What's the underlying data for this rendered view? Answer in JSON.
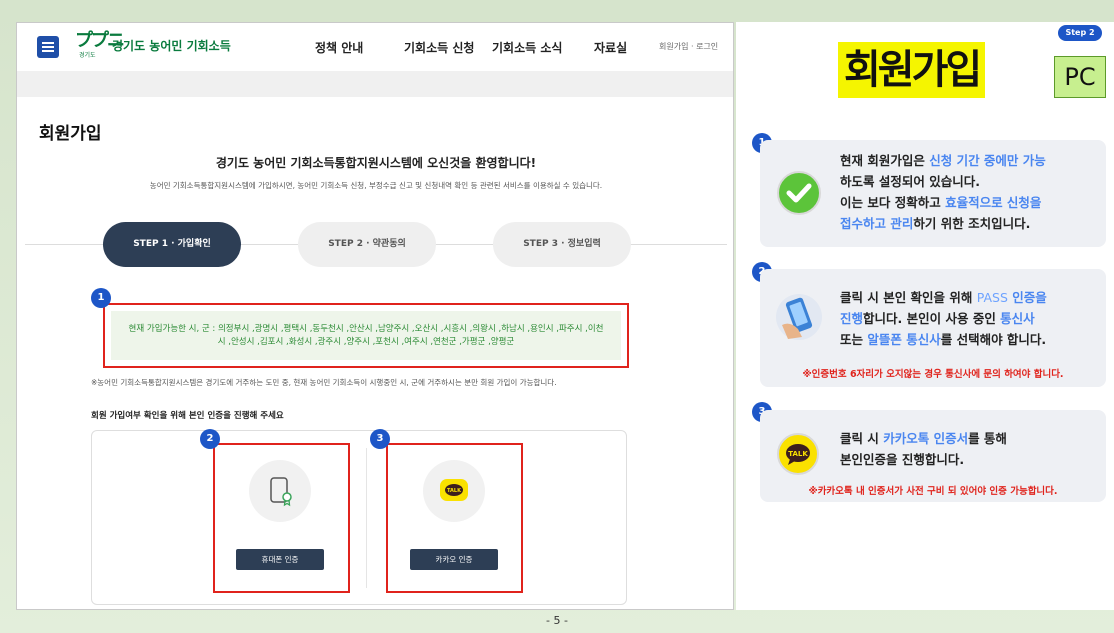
{
  "header": {
    "logo_mark": "ププニ",
    "logo_sub": "경기도",
    "logo_text": "경기도 농어민 기회소득",
    "nav": [
      "정책 안내",
      "기회소득 신청",
      "기회소득 소식",
      "자료실"
    ],
    "util": "회원가입 · 로그인"
  },
  "main": {
    "page_title": "회원가입",
    "welcome": "경기도 농어민 기회소득통합지원시스템에 오신것을 환영합니다!",
    "welcome_sub": "농어민 기회소득통합지원시스템에 가입하시면, 농어민 기회소득 신청, 부정수급 신고 및 신청내역 확인 등 관련된 서비스를 이용하실 수 있습니다.",
    "steps": [
      "STEP 1 · 가입확인",
      "STEP 2 · 약관동의",
      "STEP 3 · 정보입력"
    ],
    "regions": "현재 가입가능한 시, 군 : 의정부시 ,광명시 ,평택시 ,동두천시 ,안산시 ,남양주시 ,오산시 ,시흥시 ,의왕시 ,하남시 ,용인시 ,파주시 ,이천시 ,안성시 ,김포시 ,화성시 ,광주시 ,양주시 ,포천시 ,여주시 ,연천군 ,가평군 ,양평군",
    "notice": "※농어민 기회소득통합지원시스템은 경기도에 거주하는 도민 중, 현재 농어민 기회소득이 시행중인 시, 군에 거주하시는 분만 회원 가입이 가능합니다.",
    "verify_title": "회원 가입여부 확인을 위해 본인 인증을 진행해 주세요",
    "phone_button": "휴대폰 인증",
    "kakao_button": "카카오 인증",
    "kakao_icon_label": "TALK"
  },
  "badges": [
    "1",
    "2",
    "3"
  ],
  "right": {
    "step_badge": "Step 2",
    "title": "회원가입",
    "pc_label": "PC",
    "card1": {
      "l1a": "현재 회원가입은 ",
      "l1b": "신청 기간 중에만 가능",
      "l2": "하도록 설정되어 있습니다.",
      "l3a": "이는 보다 정확하고 ",
      "l3b": "효율적으로 신청을",
      "l4a": "접수하고 관리",
      "l4b": "하기 위한 조치입니다."
    },
    "card2": {
      "l1a": "클릭 시 본인 확인을 위해 ",
      "l1b": "PASS",
      "l1c": " 인증을",
      "l2a": "진행",
      "l2b": "합니다.  본인이 사용 중인 ",
      "l2c": "통신사",
      "l3a": "또는 ",
      "l3b": "알뜰폰 통신사",
      "l3c": "를 선택해야 합니다.",
      "warn": "※인증번호 6자리가 오지않는 경우 통신사에 문의 하여야 합니다."
    },
    "card3": {
      "l1a": "클릭 시 ",
      "l1b": "카카오톡 인증서",
      "l1c": "를 통해",
      "l2": "본인인증을 진행합니다.",
      "warn": "※카카오톡 내 인증서가 사전 구비 되 있어야 인증 가능합니다.",
      "icon_label": "TALK"
    }
  },
  "page_number": "- 5 -",
  "colors": {
    "accent": "#1d56c7",
    "navy": "#2d3e55",
    "red": "#e0231c",
    "green": "#2c8b35",
    "highlight": "#4a86f0"
  }
}
